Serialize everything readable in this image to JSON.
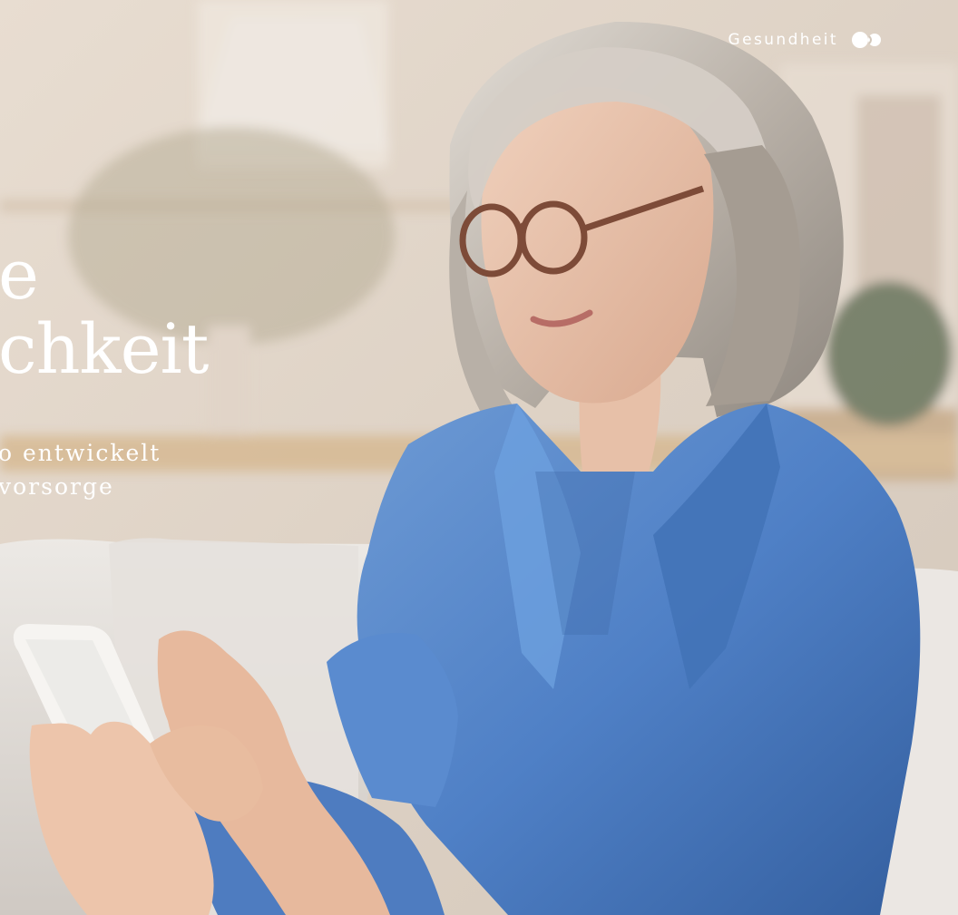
{
  "header": {
    "category_label": "Gesundheit",
    "category_icon": "brand-dots-icon"
  },
  "hero": {
    "headline_lines": [
      "e",
      "chkeit"
    ],
    "subline_lines": [
      "o entwickelt",
      "vorsorge"
    ]
  },
  "colors": {
    "text": "#ffffff",
    "shirt": "#4f80c6",
    "sofa": "#e4e0dc",
    "background": "#e2d8cd"
  }
}
